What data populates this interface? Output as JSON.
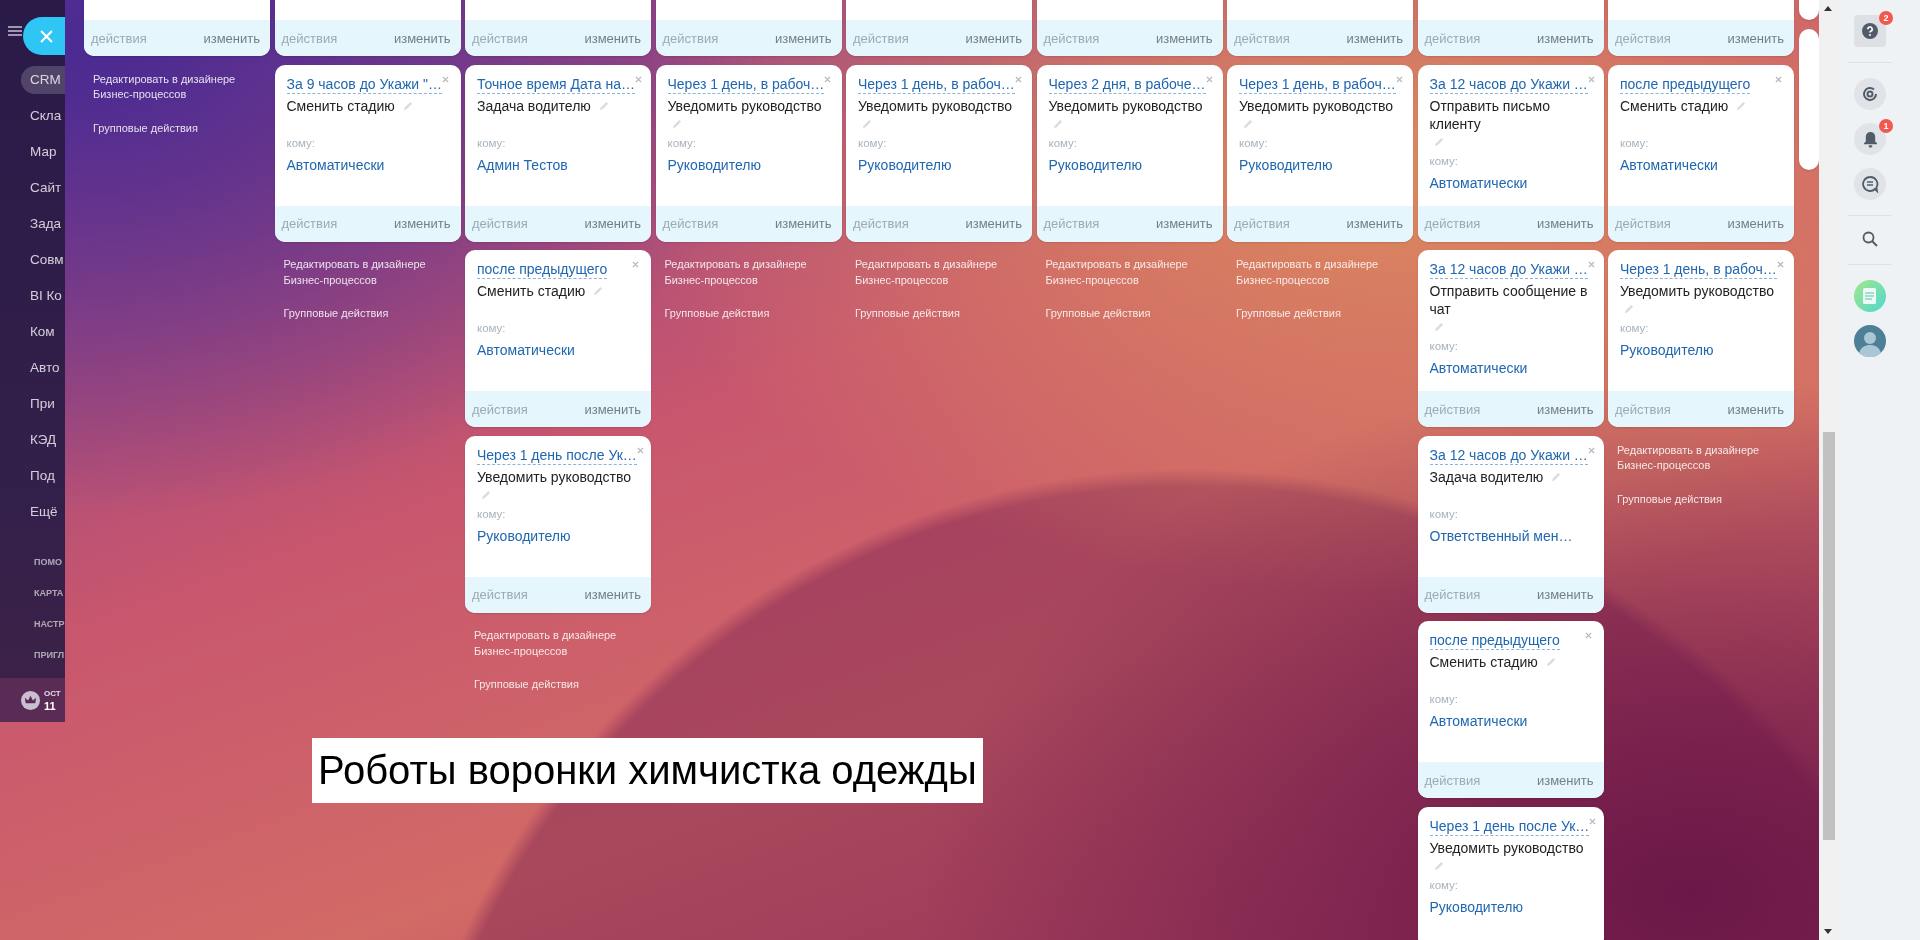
{
  "sidebar": {
    "items": [
      {
        "label": "CRM",
        "selected": true
      },
      {
        "label": "Скла",
        "selected": false
      },
      {
        "label": "Мар",
        "selected": false
      },
      {
        "label": "Сайт",
        "selected": false
      },
      {
        "label": "Зада",
        "selected": false
      },
      {
        "label": "Совм",
        "selected": false
      },
      {
        "label": "BI Ко",
        "selected": false
      },
      {
        "label": "Ком",
        "selected": false
      },
      {
        "label": "Авто",
        "selected": false
      },
      {
        "label": "При",
        "selected": false
      },
      {
        "label": "КЭД",
        "selected": false
      },
      {
        "label": "Под",
        "selected": false
      },
      {
        "label": "Ещё",
        "selected": false
      }
    ],
    "small_items": [
      "ПОМО",
      "КАРТА",
      "НАСТР",
      "ПРИГЛ"
    ],
    "tariff": {
      "line_1": "ОСТ",
      "line_2": "11"
    }
  },
  "columns": [
    {
      "cards": [
        {
          "kind": "stub",
          "actions": "действия",
          "edit": "изменить",
          "actions_disabled": true
        }
      ],
      "links": [
        "Редактировать в дизайнере Бизнес-процессов",
        "Групповые действия"
      ]
    },
    {
      "cards": [
        {
          "kind": "stub",
          "actions": "действия",
          "edit": "изменить",
          "actions_disabled": true
        },
        {
          "kind": "full",
          "condition": "За 9 часов до Укажи \"…",
          "action": "Сменить стадию",
          "to_label": "кому:",
          "to": "Автоматически",
          "actions": "действия",
          "edit": "изменить",
          "actions_disabled": true
        }
      ],
      "links": [
        "Редактировать в дизайнере Бизнес-процессов",
        "Групповые действия"
      ]
    },
    {
      "cards": [
        {
          "kind": "stub",
          "actions": "действия",
          "edit": "изменить",
          "actions_disabled": true
        },
        {
          "kind": "full",
          "condition": "Точное время Дата на…",
          "action": "Задача водителю",
          "to_label": "кому:",
          "to": "Админ Тестов",
          "actions": "действия",
          "edit": "изменить",
          "actions_disabled": true
        },
        {
          "kind": "full",
          "condition": "после предыдущего",
          "action": "Сменить стадию",
          "to_label": "кому:",
          "to": "Автоматически",
          "actions": "действия",
          "edit": "изменить",
          "actions_disabled": true
        },
        {
          "kind": "full",
          "condition": "Через 1 день после Ук…",
          "action": "Уведомить руководство",
          "to_label": "кому:",
          "to": "Руководителю",
          "actions": "действия",
          "edit": "изменить",
          "actions_disabled": true
        }
      ],
      "links": [
        "Редактировать в дизайнере Бизнес-процессов",
        "Групповые действия"
      ]
    },
    {
      "cards": [
        {
          "kind": "stub",
          "actions": "действия",
          "edit": "изменить",
          "actions_disabled": true
        },
        {
          "kind": "full",
          "condition": "Через 1 день, в рабоч…",
          "action": "Уведомить руководство",
          "to_label": "кому:",
          "to": "Руководителю",
          "actions": "действия",
          "edit": "изменить",
          "actions_disabled": true
        }
      ],
      "links": [
        "Редактировать в дизайнере Бизнес-процессов",
        "Групповые действия"
      ]
    },
    {
      "cards": [
        {
          "kind": "stub",
          "actions": "действия",
          "edit": "изменить",
          "actions_disabled": true
        },
        {
          "kind": "full",
          "condition": "Через 1 день, в рабоч…",
          "action": "Уведомить руководство",
          "to_label": "кому:",
          "to": "Руководителю",
          "actions": "действия",
          "edit": "изменить",
          "actions_disabled": true
        }
      ],
      "links": [
        "Редактировать в дизайнере Бизнес-процессов",
        "Групповые действия"
      ]
    },
    {
      "cards": [
        {
          "kind": "stub",
          "actions": "действия",
          "edit": "изменить",
          "actions_disabled": true
        },
        {
          "kind": "full",
          "condition": "Через 2 дня, в рабоче…",
          "action": "Уведомить руководство",
          "to_label": "кому:",
          "to": "Руководителю",
          "actions": "действия",
          "edit": "изменить",
          "actions_disabled": true
        }
      ],
      "links": [
        "Редактировать в дизайнере Бизнес-процессов",
        "Групповые действия"
      ]
    },
    {
      "cards": [
        {
          "kind": "stub",
          "actions": "действия",
          "edit": "изменить",
          "actions_disabled": true
        },
        {
          "kind": "full",
          "condition": "Через 1 день, в рабоч…",
          "action": "Уведомить руководство",
          "to_label": "кому:",
          "to": "Руководителю",
          "actions": "действия",
          "edit": "изменить",
          "actions_disabled": true
        }
      ],
      "links": [
        "Редактировать в дизайнере Бизнес-процессов",
        "Групповые действия"
      ]
    },
    {
      "cards": [
        {
          "kind": "stub",
          "actions": "действия",
          "edit": "изменить",
          "actions_disabled": true
        },
        {
          "kind": "full",
          "condition": "За 12 часов до Укажи …",
          "action": "Отправить письмо клиенту",
          "to_label": "кому:",
          "to": "Автоматически",
          "actions": "действия",
          "edit": "изменить",
          "actions_disabled": true
        },
        {
          "kind": "full",
          "condition": "За 12 часов до Укажи …",
          "action": "Отправить сообщение в чат",
          "to_label": "кому:",
          "to": "Автоматически",
          "actions": "действия",
          "edit": "изменить",
          "actions_disabled": true
        },
        {
          "kind": "full",
          "condition": "За 12 часов до Укажи …",
          "action": "Задача водителю",
          "to_label": "кому:",
          "to": "Ответственный мен…",
          "actions": "действия",
          "edit": "изменить",
          "actions_disabled": true
        },
        {
          "kind": "full",
          "condition": "после предыдущего",
          "action": "Сменить стадию",
          "to_label": "кому:",
          "to": "Автоматически",
          "actions": "действия",
          "edit": "изменить",
          "actions_disabled": true
        },
        {
          "kind": "full",
          "condition": "Через 1 день после Ук…",
          "action": "Уведомить руководство",
          "to_label": "кому:",
          "to": "Руководителю"
        }
      ]
    },
    {
      "cards": [
        {
          "kind": "stub",
          "actions": "действия",
          "edit": "изменить",
          "actions_disabled": true
        },
        {
          "kind": "full",
          "condition": "после предыдущего",
          "action": "Сменить стадию",
          "to_label": "кому:",
          "to": "Автоматически",
          "actions": "действия",
          "edit": "изменить",
          "actions_disabled": true
        },
        {
          "kind": "full",
          "condition": "Через 1 день, в рабоч…",
          "action": "Уведомить руководство",
          "to_label": "кому:",
          "to": "Руководителю",
          "actions": "действия",
          "edit": "изменить",
          "actions_disabled": true
        }
      ],
      "links": [
        "Редактировать в дизайнере Бизнес-процессов",
        "Групповые действия"
      ]
    },
    {
      "cards": [
        {
          "kind": "stub"
        },
        {
          "kind": "full"
        }
      ]
    }
  ],
  "caption": "Роботы воронки химчистка одежды",
  "rail": {
    "help_badge": "2",
    "notifications_badge": "1"
  }
}
